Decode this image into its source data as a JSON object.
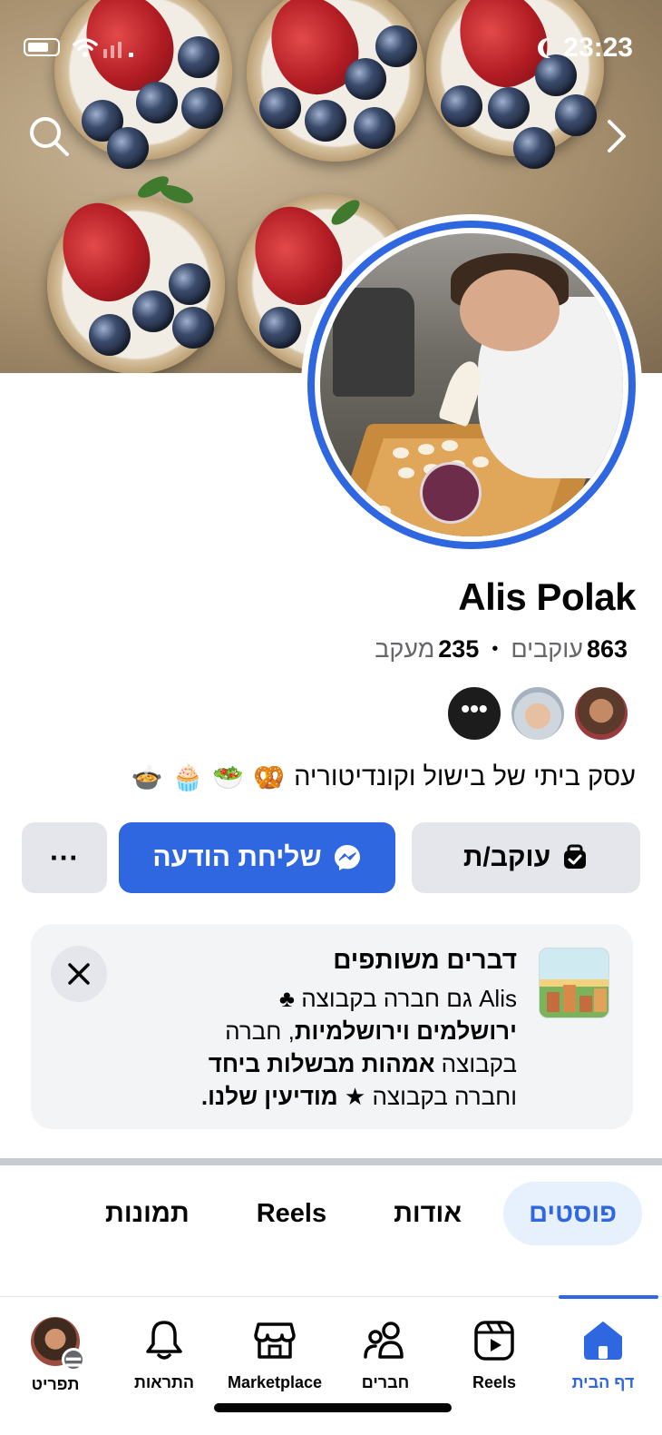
{
  "status_bar": {
    "time": "23:23"
  },
  "profile": {
    "name": "Alis Polak",
    "followers_count": "863",
    "followers_label": "עוקבים",
    "following_count": "235",
    "following_label": "מעקב",
    "stats_separator": "•",
    "more_friends_glyph": "•••",
    "bio_text": "עסק ביתי של בישול וקונדיטוריה",
    "bio_emojis": [
      "🥨",
      "🥗",
      "🧁",
      "🍲"
    ]
  },
  "actions": {
    "follow_label": "עוקב/ת",
    "message_label": "שליחת הודעה",
    "more_label": "···"
  },
  "shared_card": {
    "title": "דברים משותפים",
    "line1_prefix": "Alis גם חברה בקבוצה ♣",
    "group1": "ירושלמים וירושלמיות",
    "line2_mid": ", חברה",
    "line3_prefix": "בקבוצה ",
    "group2": "אמהות מבשלות ביחד",
    "line4_prefix": "וחברה בקבוצה ★ ",
    "group3": "מודיעין שלנו",
    "line4_suffix": "."
  },
  "tabs": [
    {
      "label": "פוסטים",
      "active": true
    },
    {
      "label": "אודות",
      "active": false
    },
    {
      "label": "Reels",
      "active": false
    },
    {
      "label": "תמונות",
      "active": false
    }
  ],
  "bottom_nav": [
    {
      "label": "דף הבית",
      "icon": "home-icon",
      "active": true
    },
    {
      "label": "Reels",
      "icon": "reels-icon",
      "active": false
    },
    {
      "label": "חברים",
      "icon": "friends-icon",
      "active": false
    },
    {
      "label": "Marketplace",
      "icon": "marketplace-icon",
      "active": false
    },
    {
      "label": "התראות",
      "icon": "bell-icon",
      "active": false
    },
    {
      "label": "תפריט",
      "icon": "menu-icon",
      "active": false
    }
  ],
  "colors": {
    "accent": "#2f67e0",
    "button_gray": "#e4e6eb",
    "card_bg": "#f3f4f6",
    "secondary_text": "#65676b"
  }
}
